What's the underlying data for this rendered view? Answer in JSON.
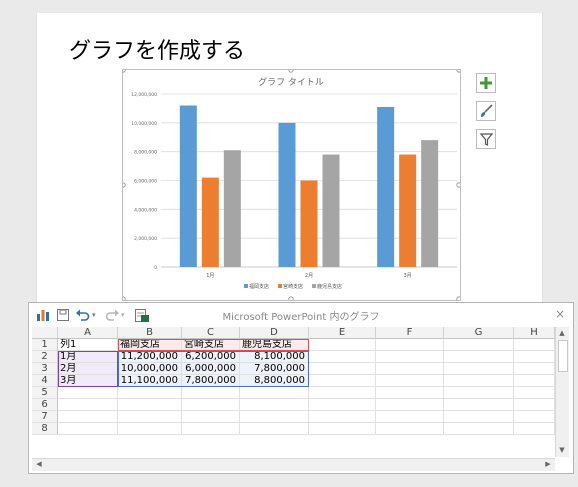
{
  "slide": {
    "title": "グラフを作成する"
  },
  "chart_data": {
    "type": "bar",
    "title": "グラフ タイトル",
    "categories": [
      "1月",
      "2月",
      "3月"
    ],
    "series": [
      {
        "name": "福岡支店",
        "values": [
          11200000,
          10000000,
          11100000
        ],
        "color": "#5b9bd5"
      },
      {
        "name": "宮崎支店",
        "values": [
          6200000,
          6000000,
          7800000
        ],
        "color": "#ed7d31"
      },
      {
        "name": "鹿児島支店",
        "values": [
          8100000,
          7800000,
          8800000
        ],
        "color": "#a5a5a5"
      }
    ],
    "yticks": [
      "12,000,000",
      "10,000,000",
      "8,000,000",
      "6,000,000",
      "4,000,000",
      "2,000,000",
      "0"
    ],
    "ylim": [
      0,
      12000000
    ],
    "grid": true,
    "legend": "bottom"
  },
  "side_buttons": [
    "plus-icon",
    "brush-icon",
    "filter-icon"
  ],
  "sheet": {
    "title": "Microsoft PowerPoint 内のグラフ",
    "columns": [
      "A",
      "B",
      "C",
      "D",
      "E",
      "F",
      "G",
      "H"
    ],
    "row_numbers": [
      "1",
      "2",
      "3",
      "4",
      "5",
      "6",
      "7",
      "8"
    ],
    "rows": [
      [
        "列1",
        "福岡支店",
        "宮崎支店",
        "鹿児島支店"
      ],
      [
        "1月",
        "11,200,000",
        "6,200,000",
        "8,100,000"
      ],
      [
        "2月",
        "10,000,000",
        "6,000,000",
        "7,800,000"
      ],
      [
        "3月",
        "11,100,000",
        "7,800,000",
        "8,800,000"
      ]
    ],
    "close": "×"
  }
}
